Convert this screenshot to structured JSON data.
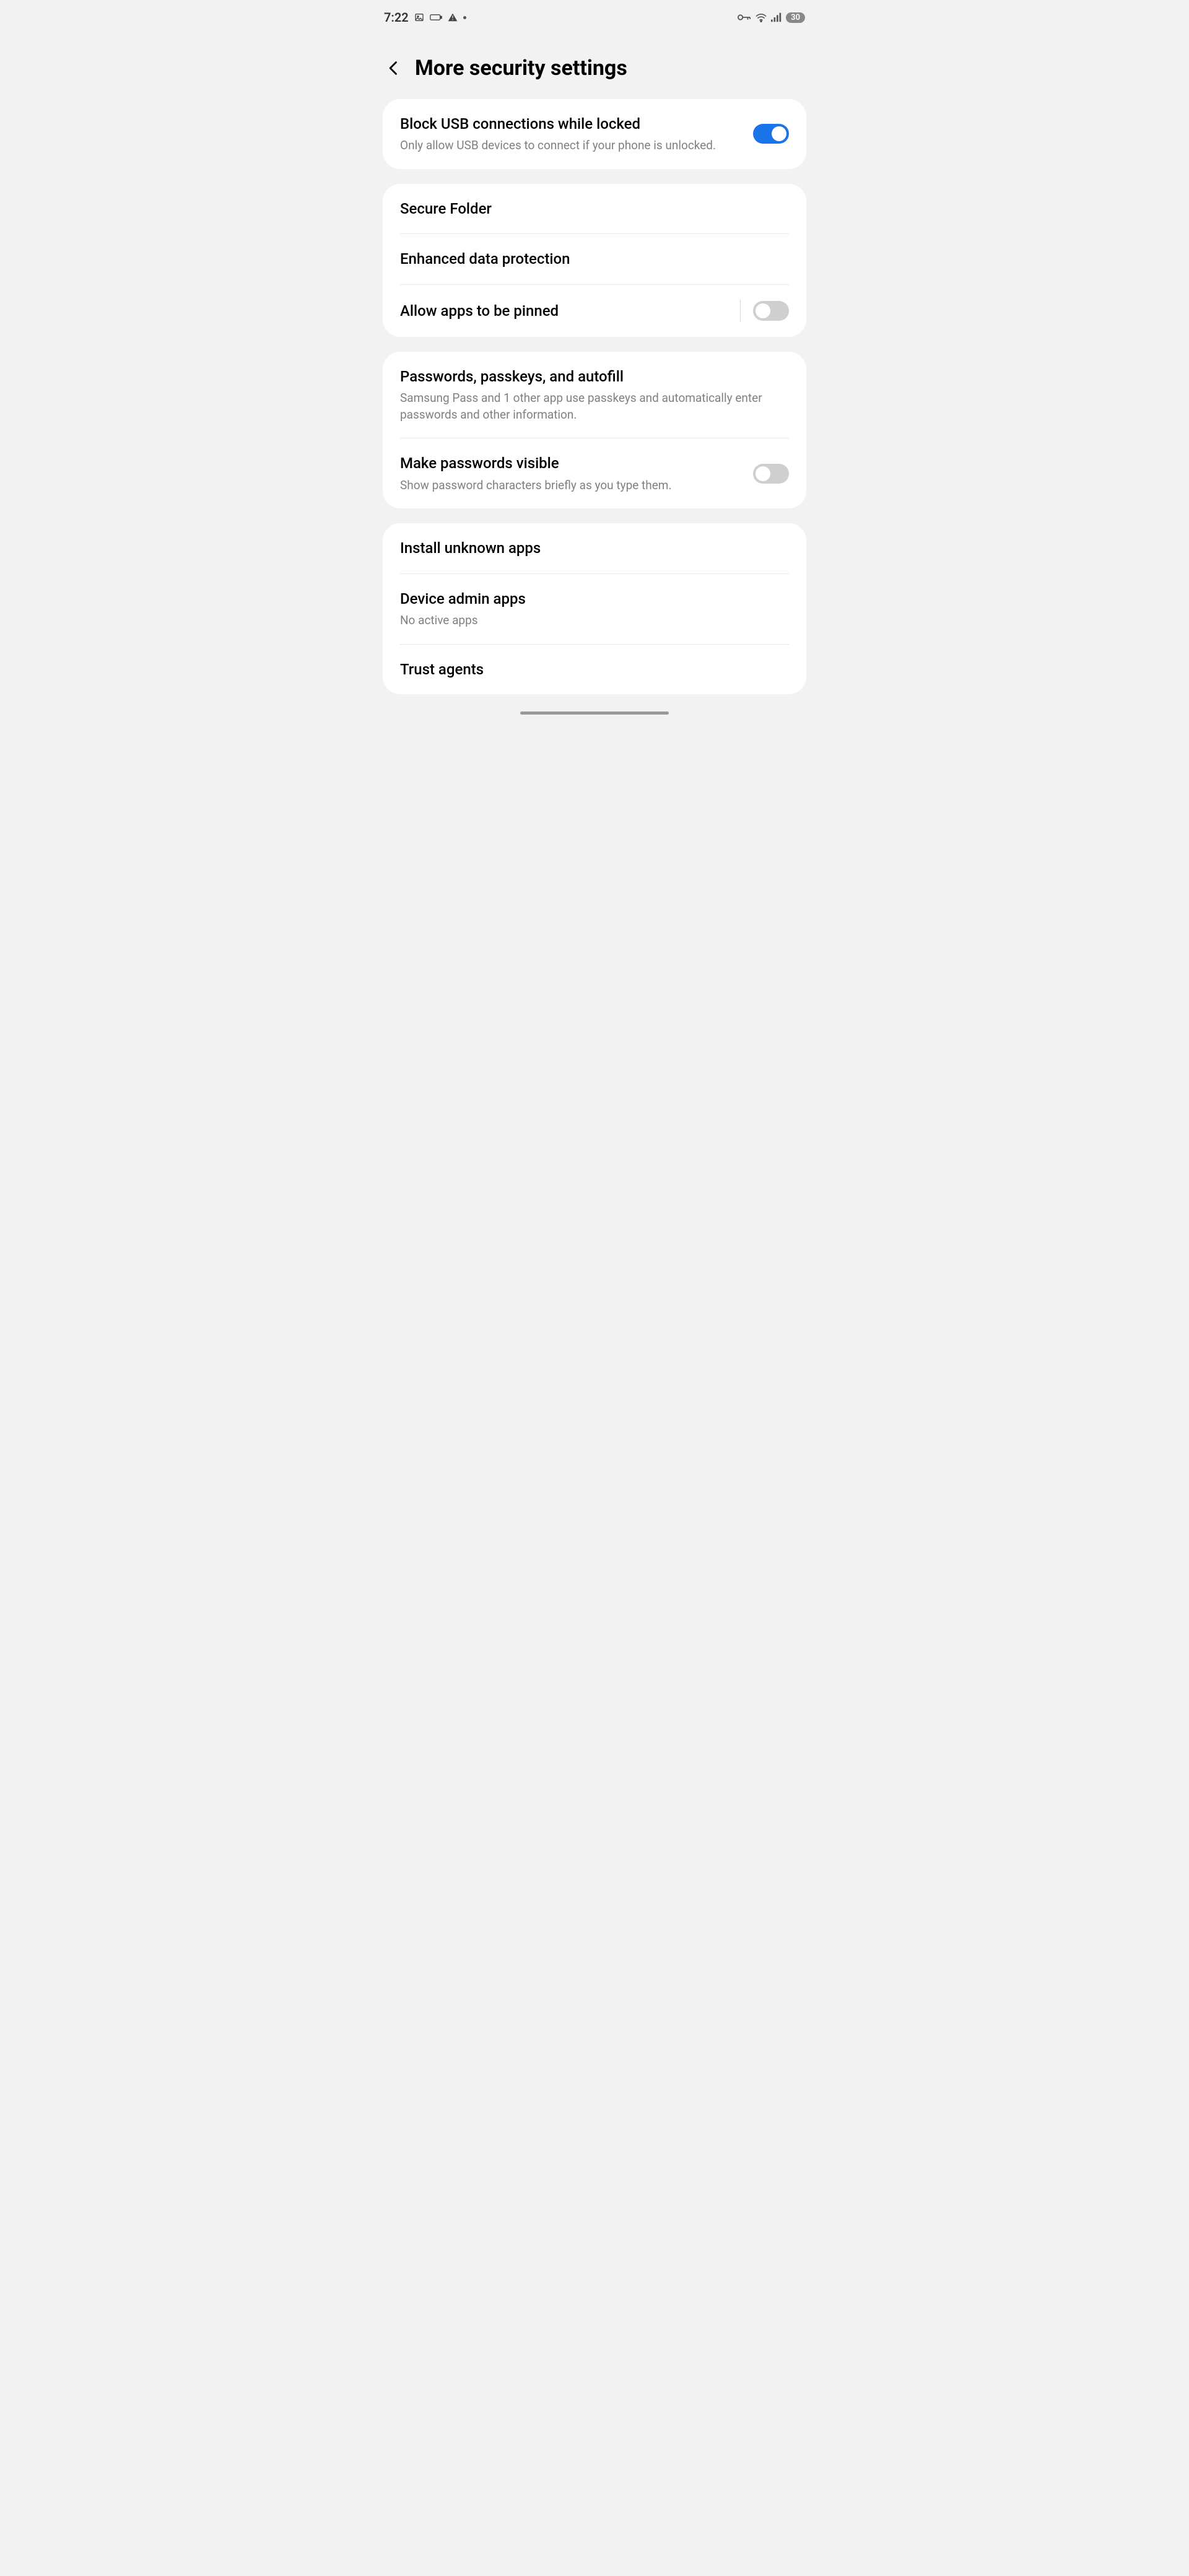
{
  "status": {
    "time": "7:22",
    "battery": "30"
  },
  "header": {
    "title": "More security settings"
  },
  "group1": {
    "block_usb": {
      "title": "Block USB connections while locked",
      "subtitle": "Only allow USB devices to connect if your phone is unlocked.",
      "enabled": true
    }
  },
  "group2": {
    "secure_folder": {
      "title": "Secure Folder"
    },
    "enhanced_data": {
      "title": "Enhanced data protection"
    },
    "allow_pinned": {
      "title": "Allow apps to be pinned",
      "enabled": false
    }
  },
  "group3": {
    "passwords_autofill": {
      "title": "Passwords, passkeys, and autofill",
      "subtitle": "Samsung Pass and 1 other app use passkeys and automatically enter passwords and other information."
    },
    "make_visible": {
      "title": "Make passwords visible",
      "subtitle": "Show password characters briefly as you type them.",
      "enabled": false
    }
  },
  "group4": {
    "install_unknown": {
      "title": "Install unknown apps"
    },
    "device_admin": {
      "title": "Device admin apps",
      "subtitle": "No active apps"
    },
    "trust_agents": {
      "title": "Trust agents"
    }
  }
}
